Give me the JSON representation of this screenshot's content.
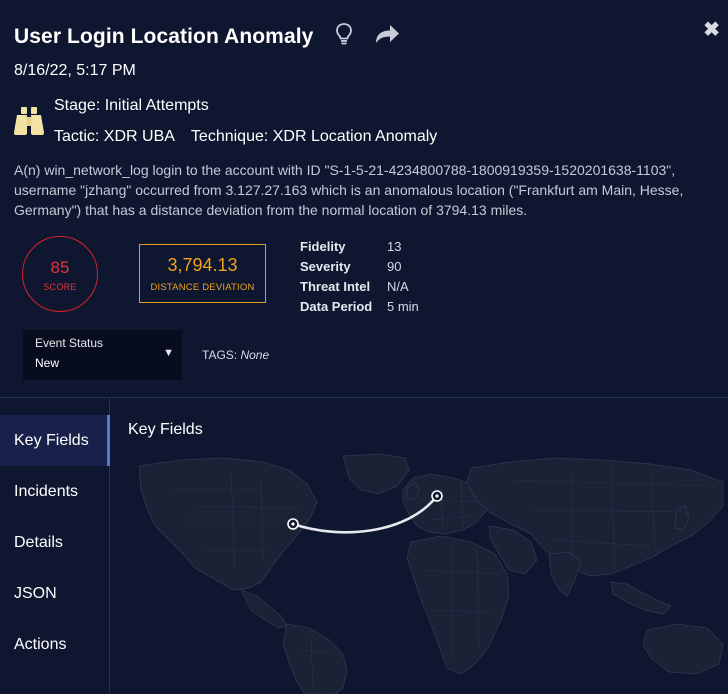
{
  "header": {
    "title": "User Login Location Anomaly",
    "timestamp": "8/16/22, 5:17 PM"
  },
  "stage": {
    "label": "Stage: Initial Attempts",
    "tactic": "Tactic: XDR UBA",
    "technique": "Technique: XDR Location Anomaly"
  },
  "description": "A(n) win_network_log login to the account with ID \"S-1-5-21-4234800788-1800919359-1520201638-1103\", username \"jzhang\" occurred from 3.127.27.163 which is an anomalous location (\"Frankfurt am Main, Hesse, Germany\") that has a distance deviation from the normal location of 3794.13 miles.",
  "score": {
    "value": "85",
    "label": "SCORE",
    "color": "#d6232a"
  },
  "distance": {
    "value": "3,794.13",
    "label": "DISTANCE DEVIATION",
    "color": "#f0a31b"
  },
  "stats": [
    {
      "key": "Fidelity",
      "value": "13"
    },
    {
      "key": "Severity",
      "value": "90"
    },
    {
      "key": "Threat Intel",
      "value": "N/A"
    },
    {
      "key": "Data Period",
      "value": "5 min"
    }
  ],
  "event_status": {
    "label": "Event Status",
    "value": "New"
  },
  "tags": {
    "label": "TAGS:",
    "value": "None"
  },
  "nav": {
    "items": [
      {
        "label": "Key Fields",
        "active": true
      },
      {
        "label": "Incidents"
      },
      {
        "label": "Details"
      },
      {
        "label": "JSON"
      },
      {
        "label": "Actions"
      }
    ]
  },
  "panel": {
    "title": "Key Fields"
  },
  "icons": [
    "lightbulb-icon",
    "share-icon",
    "close-icon",
    "binoculars-icon",
    "caret-down-icon"
  ]
}
